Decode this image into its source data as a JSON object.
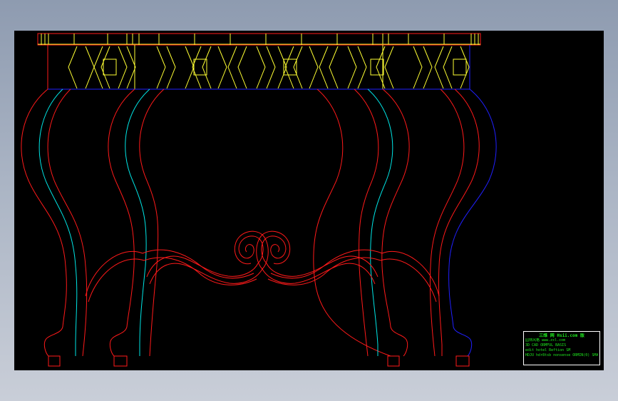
{
  "title_block": {
    "line1": "三维 网  Hsii.com 版",
    "line2": "园林风格  www.zxl.com",
    "line3": "3D CAD  ORMFUL  BASIS",
    "line4": "edit  hotel  Reftion  SM",
    "line5": "HDJU  hdr8tsb nonsense ORMIN(0)  SMAZT"
  },
  "colors": {
    "background": "#000000",
    "outline_red": "#ff1a1a",
    "outline_cyan": "#00e5e5",
    "outline_blue": "#2020ff",
    "pattern_yellow": "#ffff33",
    "title_green": "#1ee81e"
  }
}
